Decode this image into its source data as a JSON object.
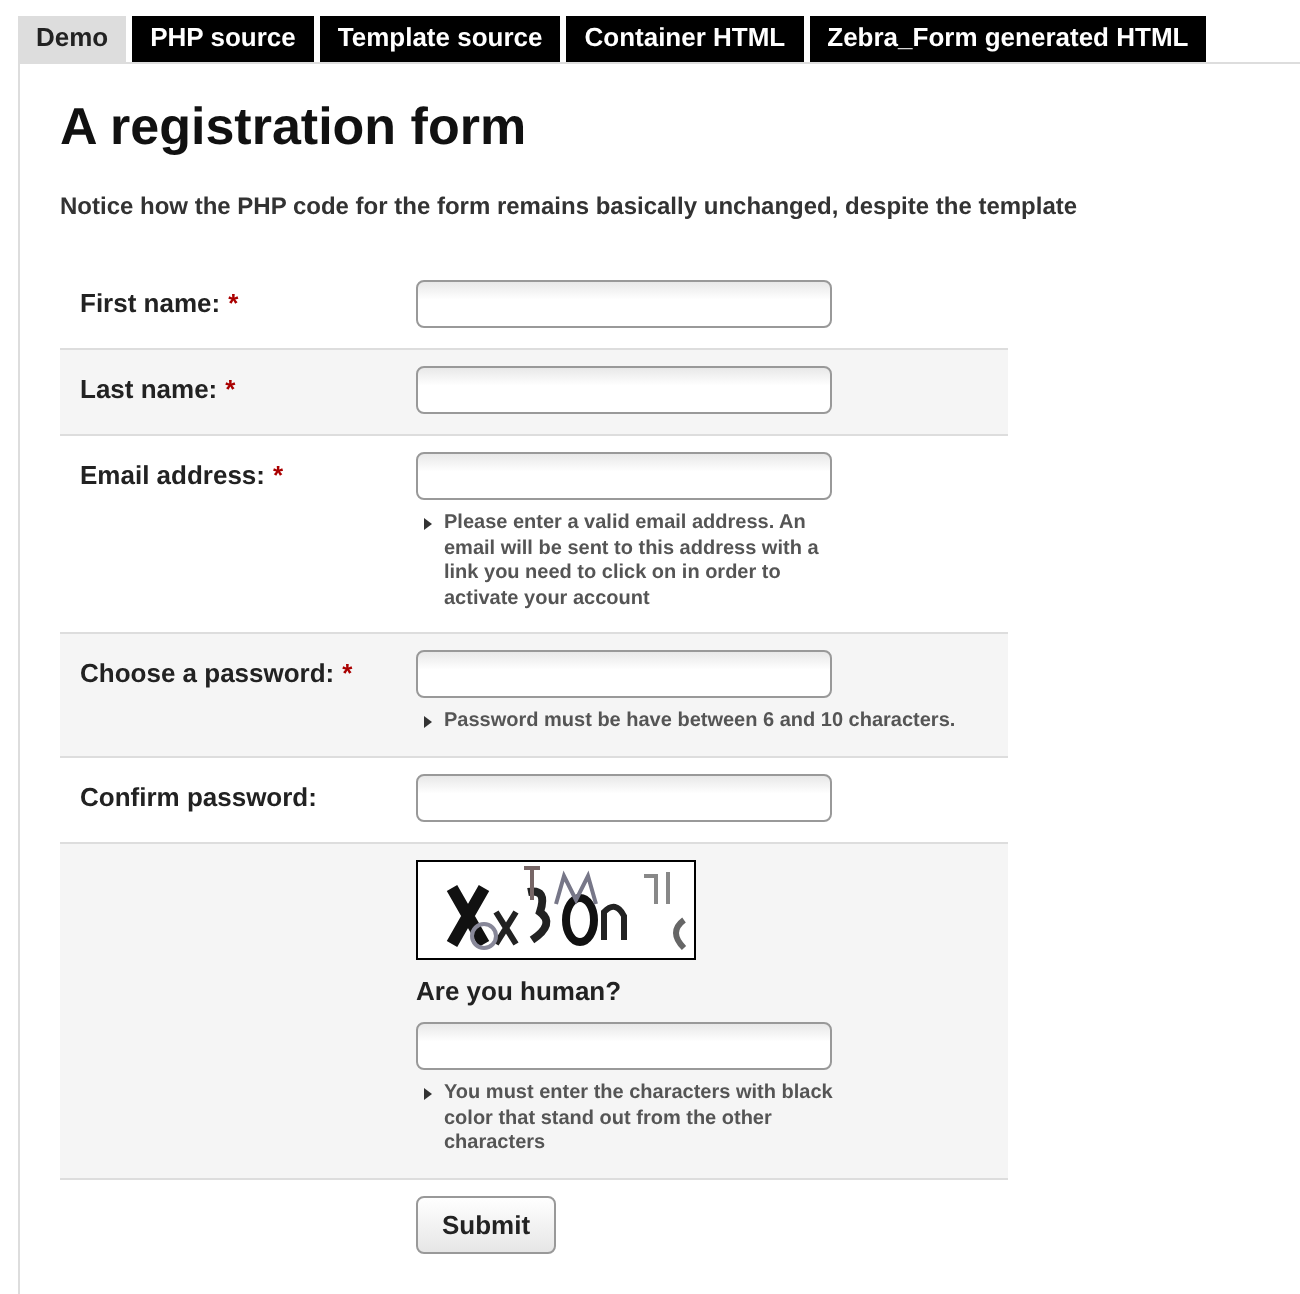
{
  "tabs": [
    {
      "label": "Demo",
      "selected": true
    },
    {
      "label": "PHP source",
      "selected": false
    },
    {
      "label": "Template source",
      "selected": false
    },
    {
      "label": "Container HTML",
      "selected": false
    },
    {
      "label": "Zebra_Form generated HTML",
      "selected": false
    }
  ],
  "title": "A registration form",
  "intro": "Notice how the PHP code for the form remains basically unchanged, despite the template",
  "fields": [
    {
      "kind": "text",
      "label": "First name:",
      "required_mark": "*"
    },
    {
      "kind": "text",
      "label": "Last name:",
      "required_mark": "*"
    },
    {
      "kind": "text",
      "label": "Email address:",
      "required_mark": "*",
      "note": "Please enter a valid email address. An email will be sent to this address with a link you need to click on in order to activate your account"
    },
    {
      "kind": "password",
      "label": "Choose a password:",
      "required_mark": "*",
      "note": "Password must be have between 6 and 10 characters."
    },
    {
      "kind": "password",
      "label": "Confirm password:"
    },
    {
      "kind": "captcha",
      "label": "Are you human?",
      "note": "You must enter the characters with black color that stand out from the other characters"
    }
  ],
  "submit": "Submit"
}
